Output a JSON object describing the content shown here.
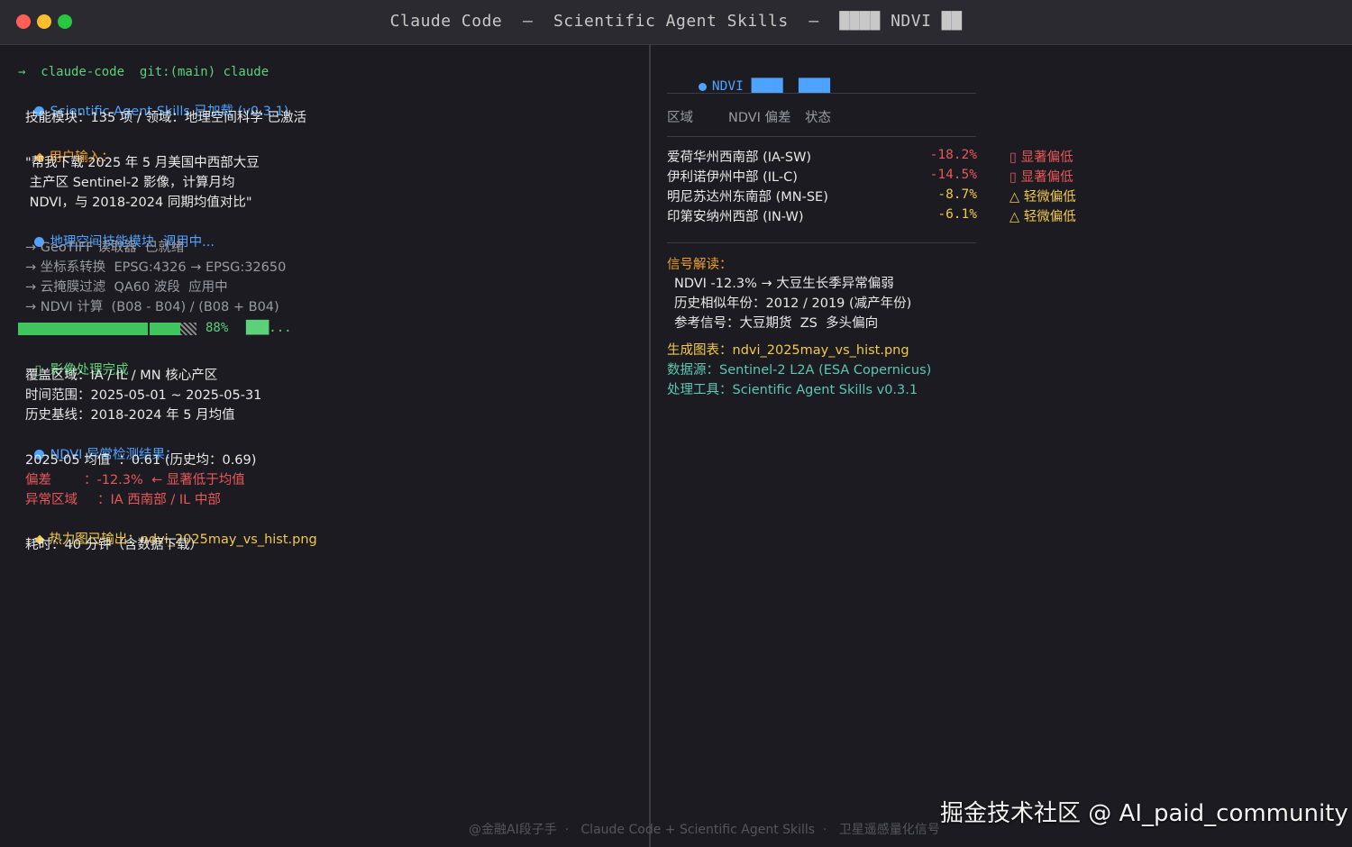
{
  "window": {
    "title": "Claude Code  —  Scientific Agent Skills  —  ████ NDVI ██"
  },
  "left": {
    "prompt": "→  claude-code  git:(main) claude",
    "skill_loaded": "Scientific Agent Skills 已加载 (v0.3.1)",
    "skill_count": "技能模块：135 项 / 领域：地理空间科学 已激活",
    "user_input_label": "用户输入：",
    "user_input_lines": [
      "\"帮我下载 2025 年 5 月美国中西部大豆",
      " 主产区 Sentinel-2 影像，计算月均",
      " NDVI，与 2018-2024 同期均值对比\""
    ],
    "module_calling": "地理空间技能模块  调用中...",
    "steps": [
      "→ GeoTIFF 读取器  已就绪",
      "→ 坐标系转换  EPSG:4326 → EPSG:32650",
      "→ 云掩膜过滤  QA60 波段  应用中",
      "→ NDVI 计算  (B08 - B04) / (B08 + B04)"
    ],
    "progress": {
      "value": 0.88,
      "label": "88%",
      "status": "███..."
    },
    "done_icon": "▯",
    "done_label": "影像处理完成",
    "done_lines": [
      "覆盖区域：IA / IL / MN 核心产区",
      "时间范围：2025-05-01 ~ 2025-05-31",
      "历史基线：2018-2024 年 5 月均值"
    ],
    "anomaly_title": "NDVI 异常检测结果：",
    "anomaly_mean": "2025-05 均值  ：0.61 (历史均：0.69)",
    "anomaly_dev_label": "偏差",
    "anomaly_dev_value": "：-12.3%  ← 显著低于均值",
    "anomaly_region_label": "异常区域",
    "anomaly_region_value": "：IA 西南部 / IL 中部",
    "heatmap_output": "热力图已输出：ndvi_2025may_vs_hist.png",
    "elapsed": "耗时：40 分钟（含数据下载）"
  },
  "right": {
    "header": "NDVI ████  ████",
    "col_region": "区域",
    "col_dev": "NDVI 偏差",
    "col_status": "状态",
    "rows": [
      {
        "region": "爱荷华州西南部 (IA-SW)",
        "value": "-18.2%",
        "status": "▯ 显著偏低",
        "severity": "high"
      },
      {
        "region": "伊利诺伊州中部 (IL-C)",
        "value": "-14.5%",
        "status": "▯ 显著偏低",
        "severity": "high"
      },
      {
        "region": "明尼苏达州东南部 (MN-SE)",
        "value": "-8.7%",
        "status": "△ 轻微偏低",
        "severity": "low"
      },
      {
        "region": "印第安纳州西部 (IN-W)",
        "value": "-6.1%",
        "status": "△ 轻微偏低",
        "severity": "low"
      }
    ],
    "signal_title": "信号解读：",
    "signal_lines": [
      "NDVI -12.3% → 大豆生长季异常偏弱",
      "历史相似年份：2012 / 2019 (减产年份)",
      "参考信号：大豆期货  ZS  多头偏向"
    ],
    "chart_file": "生成图表：ndvi_2025may_vs_hist.png",
    "data_source": "数据源：Sentinel-2 L2A (ESA Copernicus)",
    "tool": "处理工具：Scientific Agent Skills v0.3.1"
  },
  "footer": {
    "left": "@金融AI段子手  ·   Claude Code + Scientific Agent Skills  ·   卫星遥感量化信号",
    "watermark": "掘金技术社区 @ AI_paid_community"
  },
  "colors": {
    "background": "#1b1b21",
    "accent_blue": "#4da3ff",
    "accent_green": "#5dd17a",
    "accent_orange": "#f0a020",
    "warn_red": "#e8585a",
    "warn_yellow": "#f2c94c"
  }
}
